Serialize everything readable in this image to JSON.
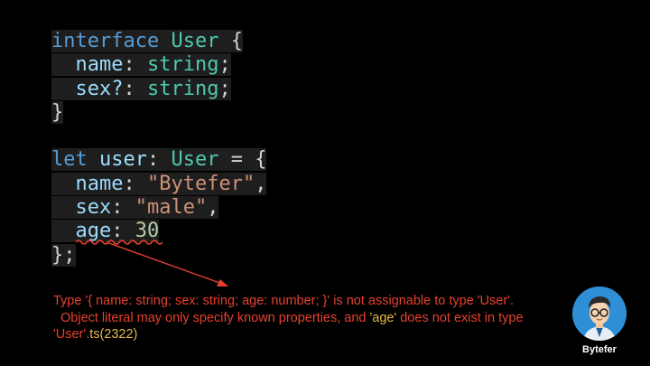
{
  "code": {
    "l1": {
      "kw": "interface",
      "name": "User",
      "brace": "{"
    },
    "l2": {
      "prop": "name",
      "colon": ":",
      "type": "string",
      "semi": ";"
    },
    "l3": {
      "prop": "sex?",
      "colon": ":",
      "type": "string",
      "semi": ";"
    },
    "l4": {
      "brace": "}"
    },
    "l6": {
      "kw": "let",
      "var": "user",
      "colon": ":",
      "type": "User",
      "eq": "=",
      "brace": "{"
    },
    "l7": {
      "prop": "name",
      "colon": ":",
      "value": "\"Bytefer\"",
      "comma": ","
    },
    "l8": {
      "prop": "sex",
      "colon": ":",
      "value": "\"male\"",
      "comma": ","
    },
    "l9": {
      "prop": "age",
      "colon": ":",
      "value": "30"
    },
    "l10": {
      "end": "};"
    }
  },
  "error": {
    "part1": "Type '{ name: string; sex: string; age: number; }' is not assignable to type 'User'.",
    "part2a": "Object literal may only specify known properties, and ",
    "part2b": "'age'",
    "part2c": " does not exist in type",
    "part3a": "'User'.",
    "part3b": "ts(2322)"
  },
  "brand": {
    "name": "Bytefer",
    "avatar_icon": "developer-avatar-icon",
    "avatar_bg": "#2e8fd6"
  }
}
